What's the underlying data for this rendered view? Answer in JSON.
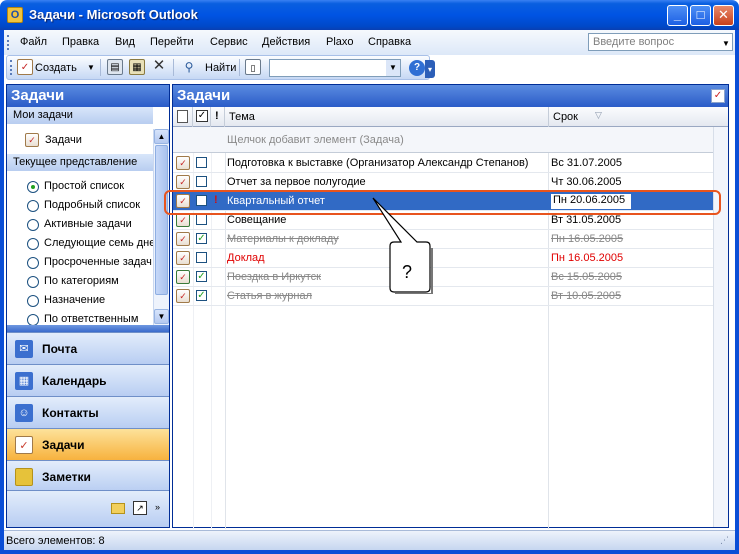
{
  "window": {
    "title": "Задачи - Microsoft Outlook",
    "minimize_glyph": "_",
    "maximize_glyph": "□",
    "close_glyph": "✕"
  },
  "menu": {
    "items": [
      "Файл",
      "Правка",
      "Вид",
      "Перейти",
      "Сервис",
      "Действия",
      "Plaxo",
      "Справка"
    ],
    "help_placeholder": "Введите вопрос"
  },
  "toolbar": {
    "create_label": "Создать",
    "find_label": "Найти",
    "combo_value": "",
    "help_glyph": "?"
  },
  "nav": {
    "header": "Задачи",
    "my_tasks_section": "Мои задачи",
    "my_tasks_item": "Задачи",
    "current_view_section": "Текущее представление",
    "views": [
      {
        "label": "Простой список",
        "checked": true
      },
      {
        "label": "Подробный список",
        "checked": false
      },
      {
        "label": "Активные задачи",
        "checked": false
      },
      {
        "label": "Следующие семь дне",
        "checked": false
      },
      {
        "label": "Просроченные задач",
        "checked": false
      },
      {
        "label": "По категориям",
        "checked": false
      },
      {
        "label": "Назначение",
        "checked": false
      },
      {
        "label": "По ответственным",
        "checked": false
      }
    ],
    "buttons": [
      {
        "label": "Почта",
        "icon": "mail-icon",
        "color": "#3b6fcf",
        "active": false
      },
      {
        "label": "Календарь",
        "icon": "calendar-icon",
        "color": "#3b6fcf",
        "active": false
      },
      {
        "label": "Контакты",
        "icon": "contacts-icon",
        "color": "#3b6fcf",
        "active": false
      },
      {
        "label": "Задачи",
        "icon": "tasks-icon",
        "color": "#c83a2a",
        "active": true
      },
      {
        "label": "Заметки",
        "icon": "notes-icon",
        "color": "#e6c23a",
        "active": false
      }
    ]
  },
  "main": {
    "header": "Задачи",
    "columns": {
      "subject": "Тема",
      "due": "Срок"
    },
    "new_item_text": "Щелчок добавит элемент (Задача)",
    "tasks": [
      {
        "subject": "Подготовка к выставке (Организатор Александр Степанов)",
        "due": "Вс 31.07.2005",
        "done": false,
        "overdue": false,
        "priority": false,
        "selected": false
      },
      {
        "subject": "Отчет за первое полугодие",
        "due": "Чт 30.06.2005",
        "done": false,
        "overdue": false,
        "priority": false,
        "selected": false
      },
      {
        "subject": "Квартальный отчет",
        "due": "Пн 20.06.2005",
        "done": false,
        "overdue": false,
        "priority": true,
        "selected": true
      },
      {
        "subject": "Совещание",
        "due": "Вт 31.05.2005",
        "done": false,
        "overdue": false,
        "priority": false,
        "selected": false
      },
      {
        "subject": "Материалы к докладу",
        "due": "Пн 16.05.2005",
        "done": true,
        "overdue": false,
        "priority": false,
        "selected": false
      },
      {
        "subject": "Доклад",
        "due": "Пн 16.05.2005",
        "done": false,
        "overdue": true,
        "priority": false,
        "selected": false
      },
      {
        "subject": "Поездка в Иркутск",
        "due": "Вс 15.05.2005",
        "done": true,
        "overdue": false,
        "priority": false,
        "selected": false
      },
      {
        "subject": "Статья в журнал",
        "due": "Вт 10.05.2005",
        "done": true,
        "overdue": false,
        "priority": false,
        "selected": false
      }
    ],
    "callout_text": "?"
  },
  "status": {
    "text": "Всего элементов: 8"
  }
}
